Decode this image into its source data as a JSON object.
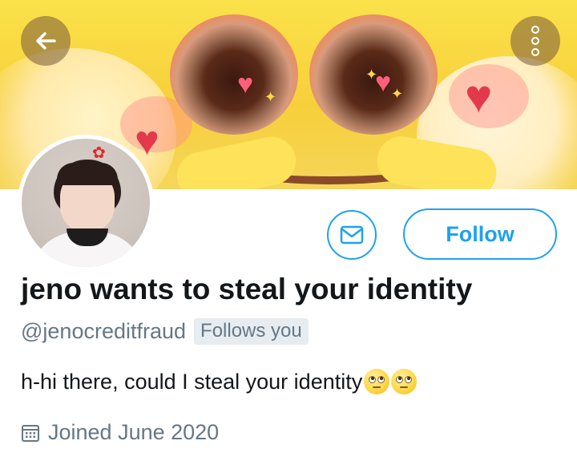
{
  "banner": {
    "image_name": "emoji-header-banner"
  },
  "nav": {
    "back_icon": "arrow-left-icon",
    "more_icon": "more-options-icon"
  },
  "profile": {
    "display_name": "jeno wants to steal your identity",
    "handle": "@jenocreditfraud",
    "follows_you_badge": "Follows you",
    "bio": "h-hi there, could I steal your identity",
    "joined": "Joined June 2020"
  },
  "actions": {
    "follow_label": "Follow",
    "message_icon": "envelope-icon"
  },
  "colors": {
    "accent": "#1da1f2",
    "secondary_text": "#657786",
    "badge_bg": "#e6ecf0"
  }
}
